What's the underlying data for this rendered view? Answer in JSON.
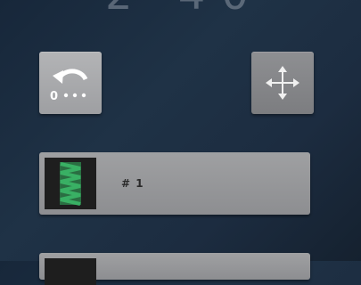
{
  "header": {
    "partial_text": "2 40"
  },
  "toolbar": {
    "reset_position_label": "0",
    "reset_icon": "reset-to-origin-icon",
    "move_icon": "move-arrows-icon"
  },
  "stitch_list": {
    "items": [
      {
        "label": "# 1",
        "thumbnail_icon": "zigzag-stitch-icon",
        "thumbnail_color": "#2e9a55"
      },
      {
        "label": "",
        "thumbnail_icon": "stitch-thumbnail-icon",
        "thumbnail_color": "#2e9a55"
      }
    ]
  }
}
